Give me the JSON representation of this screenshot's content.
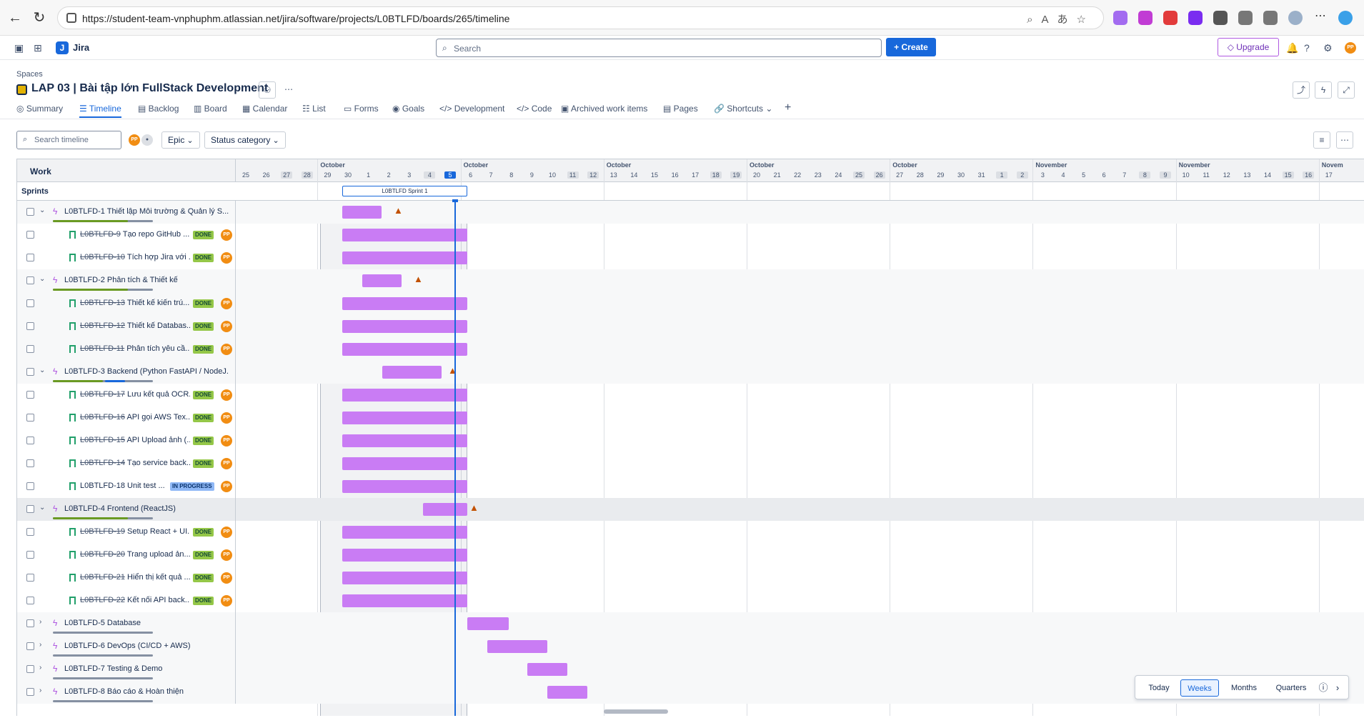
{
  "browser": {
    "url": "https://student-team-vnphuphm.atlassian.net/jira/software/projects/L0BTLFD/boards/265/timeline"
  },
  "topbar": {
    "app_name": "Jira",
    "search_placeholder": "Search",
    "create_label": "+ Create",
    "upgrade_label": "Upgrade"
  },
  "project": {
    "crumb": "Spaces",
    "title": "LAP 03 | Bài tập lớn FullStack Development"
  },
  "tabs": [
    {
      "label": "Summary"
    },
    {
      "label": "Timeline"
    },
    {
      "label": "Backlog"
    },
    {
      "label": "Board"
    },
    {
      "label": "Calendar"
    },
    {
      "label": "List"
    },
    {
      "label": "Forms"
    },
    {
      "label": "Goals"
    },
    {
      "label": "Development"
    },
    {
      "label": "Code"
    },
    {
      "label": "Archived work items"
    },
    {
      "label": "Pages"
    },
    {
      "label": "Shortcuts"
    }
  ],
  "filters": {
    "search_placeholder": "Search timeline",
    "avatar_initials": "PP",
    "epic_label": "Epic",
    "status_label": "Status category"
  },
  "timeline": {
    "work_header": "Work",
    "sprints_label": "Sprints",
    "sprint_name": "L0BTLFD Sprint 1",
    "months": [
      "October",
      "October",
      "October",
      "October",
      "October",
      "November",
      "November",
      "Novem"
    ],
    "days": [
      "25",
      "26",
      "27",
      "28",
      "29",
      "30",
      "1",
      "2",
      "3",
      "4",
      "5",
      "6",
      "7",
      "8",
      "9",
      "10",
      "11",
      "12",
      "13",
      "14",
      "15",
      "16",
      "17",
      "18",
      "19",
      "20",
      "21",
      "22",
      "23",
      "24",
      "25",
      "26",
      "27",
      "28",
      "29",
      "30",
      "31",
      "1",
      "2",
      "3",
      "4",
      "5",
      "6",
      "7",
      "8",
      "9",
      "10",
      "11",
      "12",
      "13",
      "14",
      "15",
      "16",
      "17"
    ],
    "rows": [
      {
        "type": "epic",
        "key": "L0BTLFD-1",
        "title": "Thiết lập Môi trường & Quản lý S...",
        "done": false,
        "warn": true
      },
      {
        "type": "story",
        "key": "L0BTLFD-9",
        "title": "Tạo repo GitHub ...",
        "status": "DONE",
        "done": true
      },
      {
        "type": "story",
        "key": "L0BTLFD-10",
        "title": "Tích hợp Jira với ...",
        "status": "DONE",
        "done": true
      },
      {
        "type": "epic",
        "key": "L0BTLFD-2",
        "title": "Phân tích & Thiết kế",
        "done": false,
        "warn": true
      },
      {
        "type": "story",
        "key": "L0BTLFD-13",
        "title": "Thiết kế kiến trú...",
        "status": "DONE",
        "done": true
      },
      {
        "type": "story",
        "key": "L0BTLFD-12",
        "title": "Thiết kế Databas...",
        "status": "DONE",
        "done": true
      },
      {
        "type": "story",
        "key": "L0BTLFD-11",
        "title": "Phân tích yêu cầ...",
        "status": "DONE",
        "done": true
      },
      {
        "type": "epic",
        "key": "L0BTLFD-3",
        "title": "Backend (Python FastAPI / NodeJ...",
        "done": false,
        "warn": true
      },
      {
        "type": "story",
        "key": "L0BTLFD-17",
        "title": "Lưu kết quả OCR...",
        "status": "DONE",
        "done": true
      },
      {
        "type": "story",
        "key": "L0BTLFD-16",
        "title": "API gọi AWS Tex...",
        "status": "DONE",
        "done": true
      },
      {
        "type": "story",
        "key": "L0BTLFD-15",
        "title": "API Upload ảnh (...",
        "status": "DONE",
        "done": true
      },
      {
        "type": "story",
        "key": "L0BTLFD-14",
        "title": "Tạo service back...",
        "status": "DONE",
        "done": true
      },
      {
        "type": "story",
        "key": "L0BTLFD-18",
        "title": "Unit test ...",
        "status": "IN PROGRESS",
        "done": false
      },
      {
        "type": "epic",
        "key": "L0BTLFD-4",
        "title": "Frontend (ReactJS)",
        "done": false,
        "warn": true
      },
      {
        "type": "story",
        "key": "L0BTLFD-19",
        "title": "Setup React + UI...",
        "status": "DONE",
        "done": true
      },
      {
        "type": "story",
        "key": "L0BTLFD-20",
        "title": "Trang upload ản...",
        "status": "DONE",
        "done": true
      },
      {
        "type": "story",
        "key": "L0BTLFD-21",
        "title": "Hiển thị kết quả ...",
        "status": "DONE",
        "done": true
      },
      {
        "type": "story",
        "key": "L0BTLFD-22",
        "title": "Kết nối API back...",
        "status": "DONE",
        "done": true
      },
      {
        "type": "epic",
        "key": "L0BTLFD-5",
        "title": "Database",
        "done": false,
        "warn": false
      },
      {
        "type": "epic",
        "key": "L0BTLFD-6",
        "title": "DevOps (CI/CD + AWS)",
        "done": false,
        "warn": false
      },
      {
        "type": "epic",
        "key": "L0BTLFD-7",
        "title": "Testing & Demo",
        "done": false,
        "warn": false
      },
      {
        "type": "epic",
        "key": "L0BTLFD-8",
        "title": "Báo cáo & Hoàn thiện",
        "done": false,
        "warn": false
      }
    ]
  },
  "zoom": {
    "today": "Today",
    "weeks": "Weeks",
    "months": "Months",
    "quarters": "Quarters",
    "selected": "Weeks"
  }
}
